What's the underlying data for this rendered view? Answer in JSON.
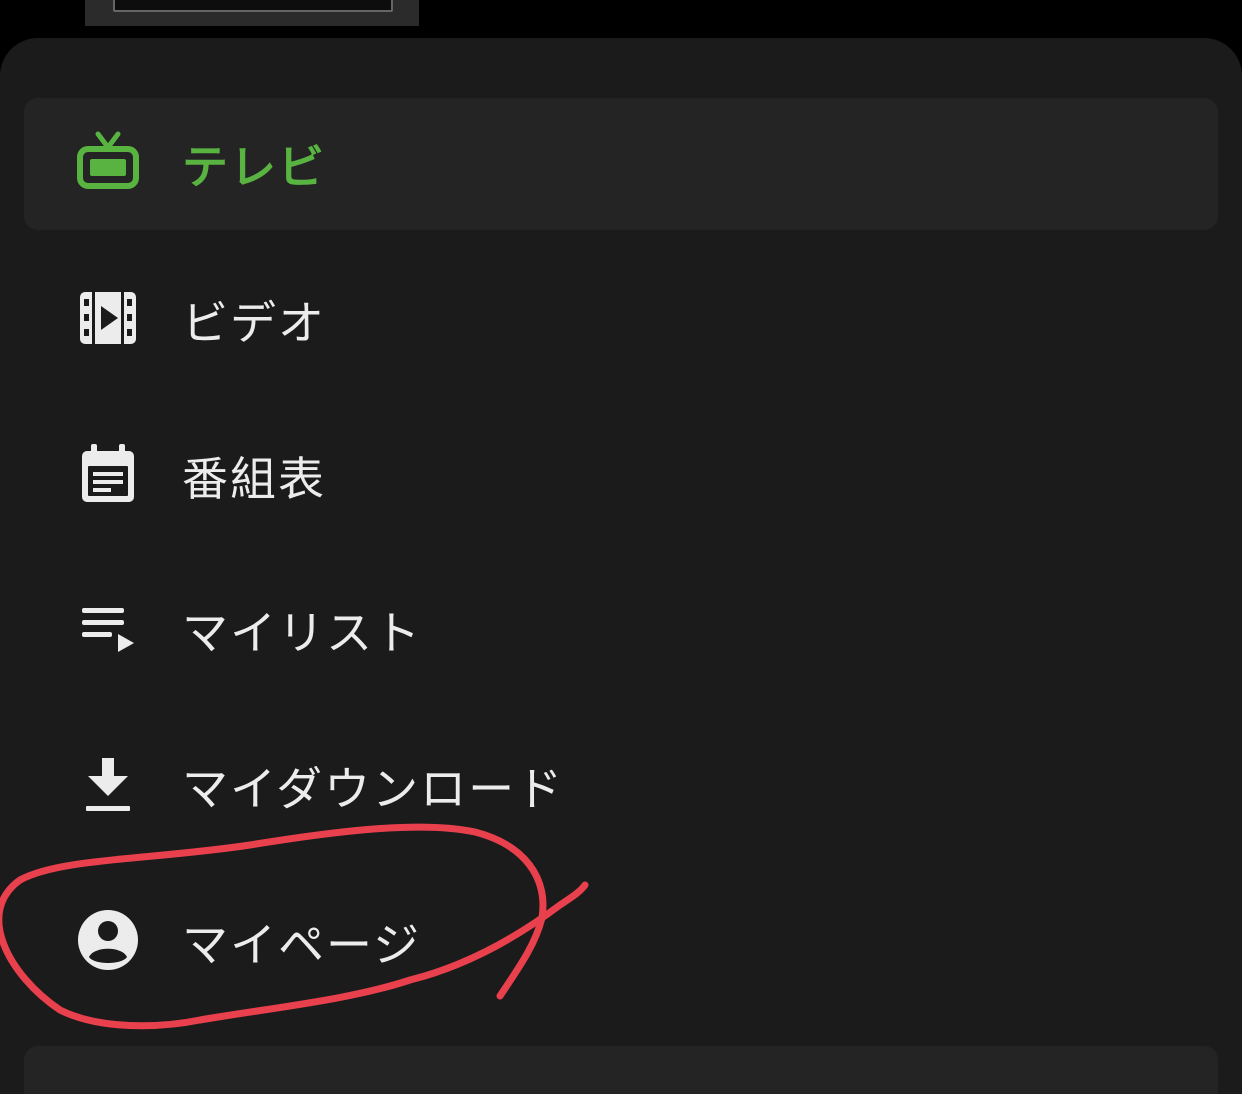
{
  "menu": {
    "items": [
      {
        "label": "テレビ",
        "icon": "tv-icon",
        "active": true
      },
      {
        "label": "ビデオ",
        "icon": "video-icon",
        "active": false
      },
      {
        "label": "番組表",
        "icon": "calendar-icon",
        "active": false
      },
      {
        "label": "マイリスト",
        "icon": "playlist-icon",
        "active": false
      },
      {
        "label": "マイダウンロード",
        "icon": "download-icon",
        "active": false
      },
      {
        "label": "マイページ",
        "icon": "account-icon",
        "active": false
      }
    ]
  },
  "colors": {
    "accent": "#58b341",
    "sheet_background": "#1b1b1b",
    "active_item_background": "#242424",
    "text": "#ececec",
    "annotation": "#e8404c"
  }
}
